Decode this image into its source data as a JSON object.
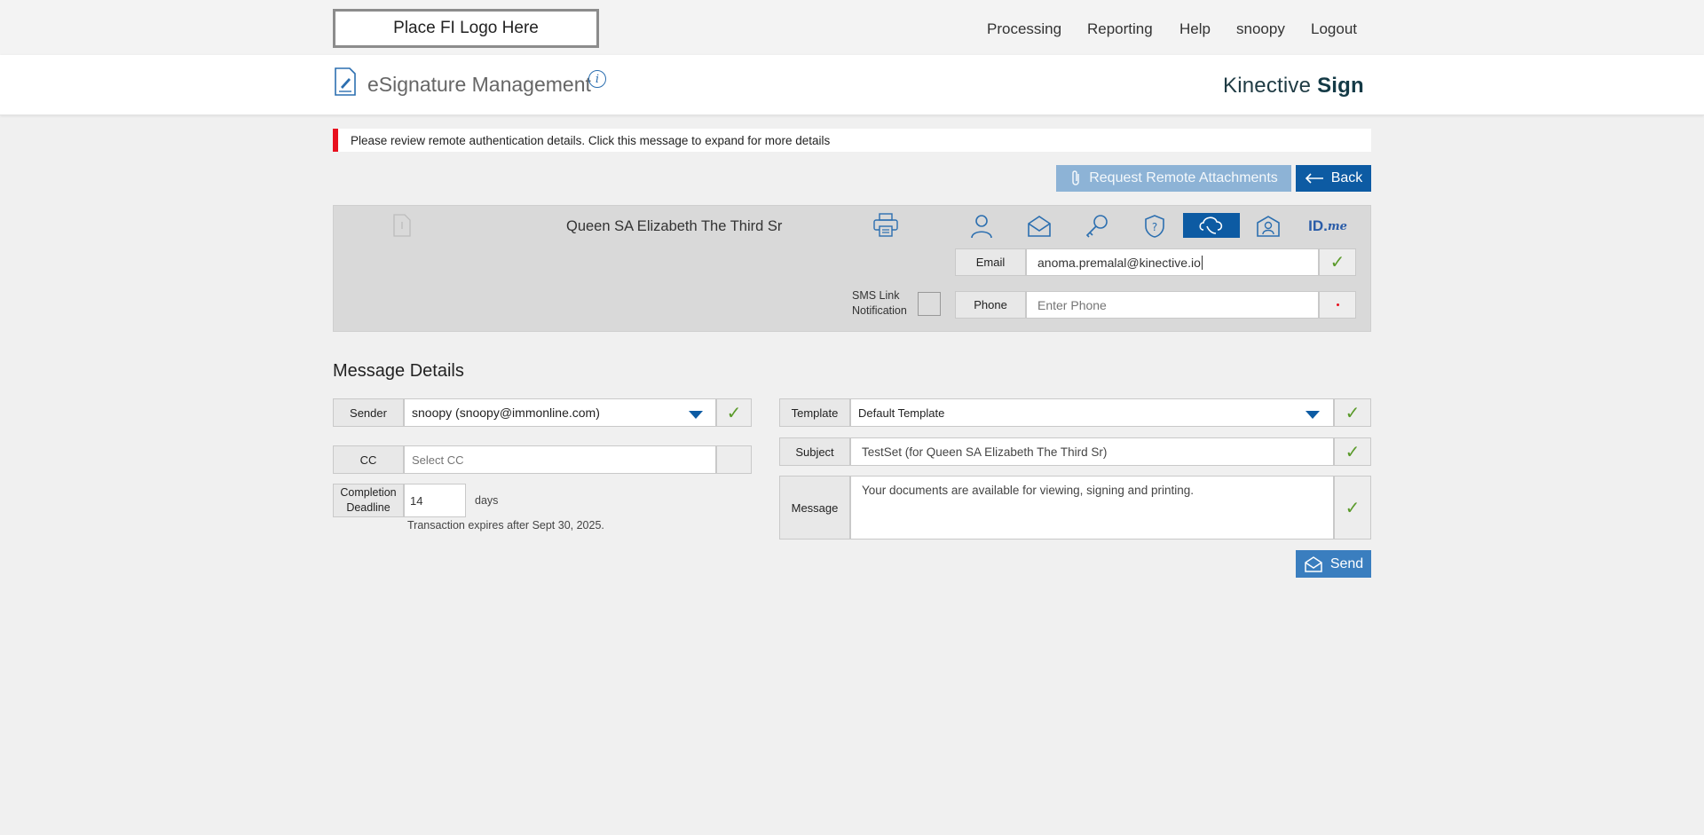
{
  "topbar": {
    "logo_text": "Place FI Logo Here",
    "nav": [
      "Processing",
      "Reporting",
      "Help",
      "snoopy",
      "Logout"
    ]
  },
  "header": {
    "title": "eSignature Management",
    "brand_regular": "Kinective ",
    "brand_bold": "Sign"
  },
  "alert": {
    "text": "Please review remote authentication details. Click this message to expand for more details",
    "color": "#e8101e"
  },
  "actions": {
    "attachments_label": "Request Remote Attachments",
    "back_label": "Back"
  },
  "signer": {
    "name": "Queen SA Elizabeth The Third Sr",
    "idme_bold": "ID.",
    "idme_italic": "me",
    "email_label": "Email",
    "email_value": "anoma.premalal@kinective.io",
    "phone_label": "Phone",
    "phone_placeholder": "Enter Phone",
    "sms_label_line1": "SMS Link",
    "sms_label_line2": "Notification",
    "sms_checked": false
  },
  "message_details": {
    "title": "Message Details",
    "sender_label": "Sender",
    "sender_value": "snoopy (snoopy@immonline.com)",
    "cc_label": "CC",
    "cc_placeholder": "Select CC",
    "deadline_label_line1": "Completion",
    "deadline_label_line2": "Deadline",
    "deadline_value": "14",
    "deadline_unit": "days",
    "expires_text": "Transaction expires after Sept 30, 2025.",
    "template_label": "Template",
    "template_value": "Default Template",
    "subject_label": "Subject",
    "subject_value": "TestSet (for Queen SA Elizabeth The Third Sr)",
    "message_label": "Message",
    "message_value": "Your documents are available for viewing, signing and printing.",
    "send_label": "Send"
  },
  "colors": {
    "primary_blue": "#0d5ba3",
    "disabled_blue": "#8db3d6",
    "check_green": "#5a9a2a",
    "error_red": "#e8101e"
  }
}
